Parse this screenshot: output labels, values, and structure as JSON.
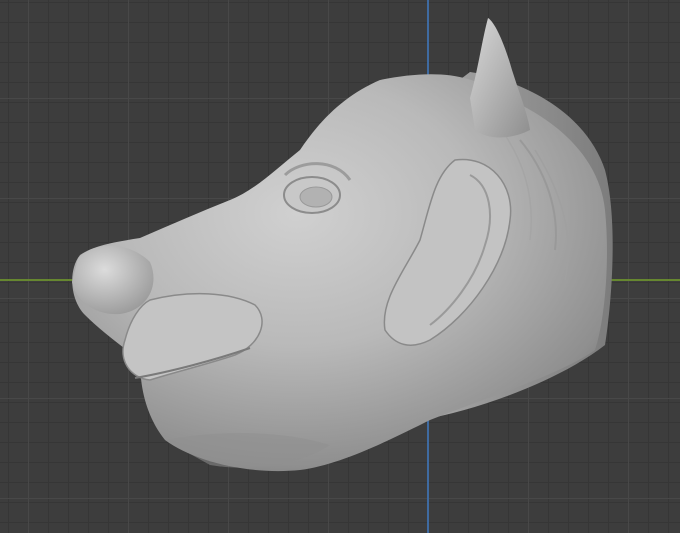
{
  "viewport": {
    "background": "#3d3d3d",
    "grid_minor_color": "#363636",
    "grid_major_color": "#484848",
    "x_axis_color": "#6a8f2f",
    "z_axis_color": "#3f6ea6",
    "model_color": "#b4b4b4"
  },
  "model": {
    "icon": "sculpted-animal-head-model",
    "parts": [
      "head",
      "ear",
      "horn",
      "eye",
      "nose",
      "mouth",
      "neck-stump"
    ]
  }
}
